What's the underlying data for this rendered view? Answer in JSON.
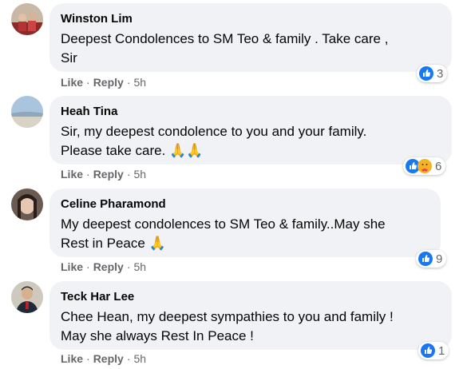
{
  "comments": [
    {
      "name": "Winston Lim",
      "text_lines": [
        "Deepest Condolences to SM Teo & family . Take care ,",
        "Sir"
      ],
      "actions": {
        "like": "Like",
        "reply": "Reply",
        "sep": "·",
        "time": "5h"
      },
      "reactions": {
        "icons": [
          "like-icon"
        ],
        "count": "3"
      }
    },
    {
      "name": "Heah Tina",
      "text_lines": [
        "Sir, my deepest condolence to you and your family.",
        "Please take care. 🙏🙏"
      ],
      "actions": {
        "like": "Like",
        "reply": "Reply",
        "sep": "·",
        "time": "5h"
      },
      "reactions": {
        "icons": [
          "like-icon",
          "care-icon"
        ],
        "count": "6"
      }
    },
    {
      "name": "Celine Pharamond",
      "text_lines": [
        "My deepest condolences to SM Teo & family..May she",
        "Rest in Peace 🙏"
      ],
      "actions": {
        "like": "Like",
        "reply": "Reply",
        "sep": "·",
        "time": "5h"
      },
      "reactions": {
        "icons": [
          "like-icon"
        ],
        "count": "9"
      }
    },
    {
      "name": "Teck Har Lee",
      "text_lines": [
        "Chee Hean, my deepest sympathies to you and family !",
        "May she always Rest In Peace !"
      ],
      "actions": {
        "like": "Like",
        "reply": "Reply",
        "sep": "·",
        "time": "5h"
      },
      "reactions": {
        "icons": [
          "like-icon"
        ],
        "count": "1"
      }
    }
  ],
  "colors": {
    "bubble": "#f0f2f5",
    "like_blue": "#1877f2",
    "muted": "#65676b"
  }
}
